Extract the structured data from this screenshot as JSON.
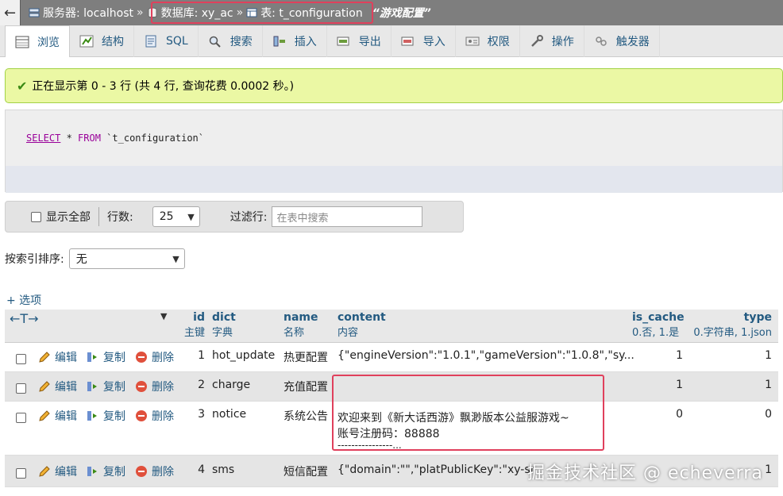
{
  "breadcrumb": {
    "server_label": "服务器: localhost",
    "db_label": "数据库: xy_ac",
    "table_label": "表: t_configuration",
    "table_comment": "“游戏配置”",
    "separator": "»"
  },
  "tabs": [
    {
      "label": "浏览",
      "icon": "browse-icon"
    },
    {
      "label": "结构",
      "icon": "structure-icon"
    },
    {
      "label": "SQL",
      "icon": "sql-icon"
    },
    {
      "label": "搜索",
      "icon": "search-icon"
    },
    {
      "label": "插入",
      "icon": "insert-icon"
    },
    {
      "label": "导出",
      "icon": "export-icon"
    },
    {
      "label": "导入",
      "icon": "import-icon"
    },
    {
      "label": "权限",
      "icon": "privileges-icon"
    },
    {
      "label": "操作",
      "icon": "operations-icon"
    },
    {
      "label": "触发器",
      "icon": "triggers-icon"
    }
  ],
  "message": {
    "text": "正在显示第 0 - 3 行 (共 4 行, 查询花费 0.0002 秒。)"
  },
  "sql": {
    "select": "SELECT",
    "rest1": " * ",
    "from": "FROM",
    "table": " `t_configuration`"
  },
  "nav": {
    "show_all": "显示全部",
    "rows_label": "行数:",
    "rows_value": "25",
    "filter_label": "过滤行:",
    "filter_placeholder": "在表中搜索"
  },
  "sort": {
    "label": "按索引排序:",
    "value": "无"
  },
  "options_link": "+ 选项",
  "columns": {
    "id": {
      "name": "id",
      "comment": "主键"
    },
    "dict": {
      "name": "dict",
      "comment": "字典"
    },
    "name": {
      "name": "name",
      "comment": "名称"
    },
    "content": {
      "name": "content",
      "comment": "内容"
    },
    "is_cache": {
      "name": "is_cache",
      "comment": "0.否, 1.是"
    },
    "type": {
      "name": "type",
      "comment": "0.字符串, 1.json"
    }
  },
  "actions": {
    "edit": "编辑",
    "copy": "复制",
    "delete": "删除"
  },
  "rows": [
    {
      "id": "1",
      "dict": "hot_update",
      "name": "热更配置",
      "content": "{\"engineVersion\":\"1.0.1\",\"gameVersion\":\"1.0.8\",\"sy...",
      "is_cache": "1",
      "type": "1"
    },
    {
      "id": "2",
      "dict": "charge",
      "name": "充值配置",
      "content": "",
      "is_cache": "1",
      "type": "1"
    },
    {
      "id": "3",
      "dict": "notice",
      "name": "系统公告",
      "content_line1": "欢迎来到《新大话西游》飘渺版本公益服游戏~",
      "content_line2": "账号注册码：88888",
      "content_line3": "----------------...",
      "is_cache": "0",
      "type": "0"
    },
    {
      "id": "4",
      "dict": "sms",
      "name": "短信配置",
      "content": "{\"domain\":\"\",\"platPublicKey\":\"xy-sr",
      "is_cache": "",
      "type": "1"
    }
  ],
  "watermark": "掘金技术社区 @ echeverra"
}
